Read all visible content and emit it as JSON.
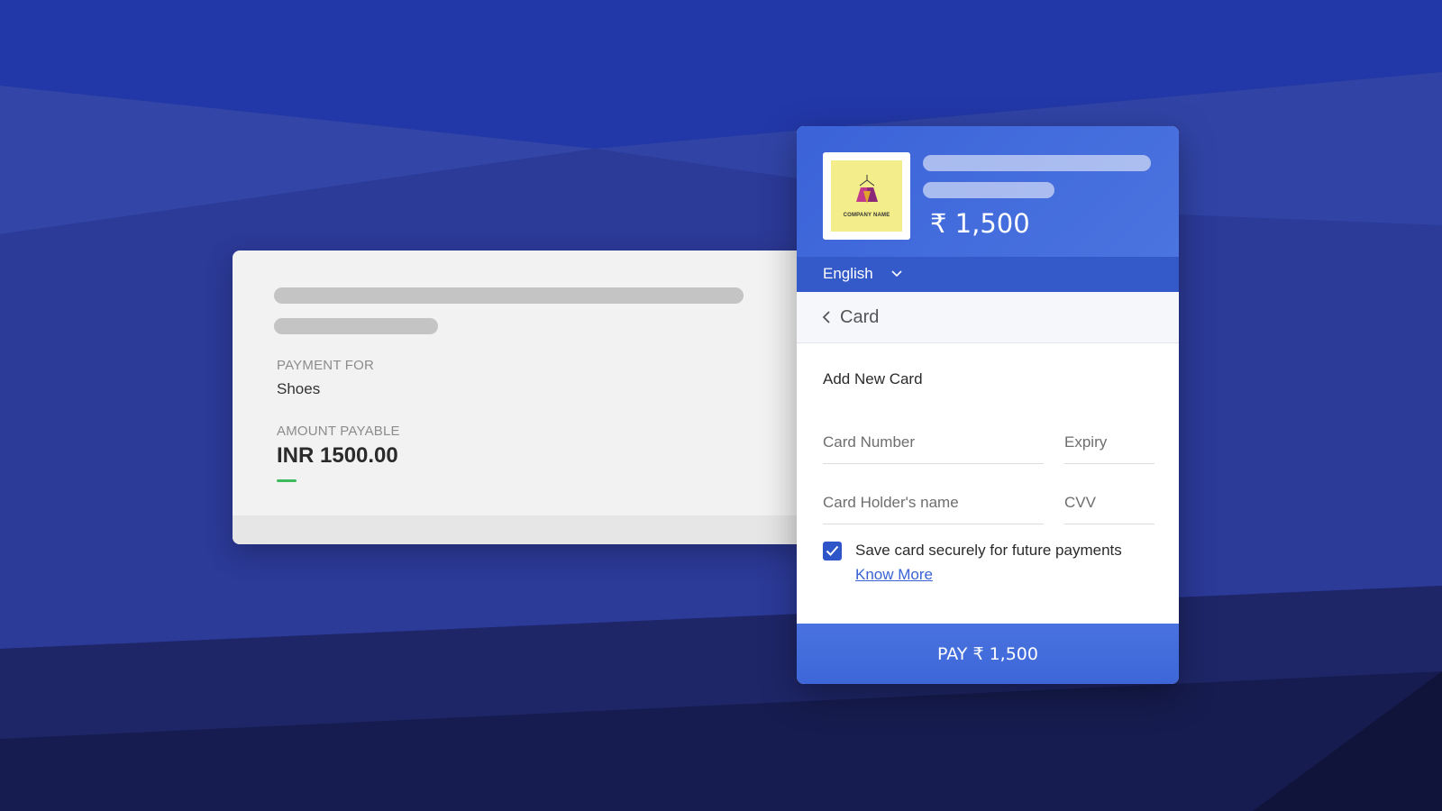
{
  "summary": {
    "payment_for_label": "PAYMENT FOR",
    "payment_for_value": "Shoes",
    "amount_label": "AMOUNT PAYABLE",
    "amount_value": "INR 1500.00"
  },
  "checkout": {
    "logo_text": "COMPANY NAME",
    "amount": "₹ 1,500",
    "language": "English",
    "method_title": "Card",
    "section_title": "Add New Card",
    "fields": {
      "card_number_placeholder": "Card Number",
      "expiry_placeholder": "Expiry",
      "holder_name_placeholder": "Card Holder's name",
      "cvv_placeholder": "CVV"
    },
    "save_card": {
      "checked": true,
      "label": "Save card securely for future payments",
      "link": "Know More"
    },
    "pay_button": "PAY ₹ 1,500"
  },
  "colors": {
    "accent": "#3b63d8",
    "success": "#3dbb5c",
    "logo_bg": "#f3ee8b"
  },
  "icons": {
    "language_dropdown": "chevron-down-icon",
    "back": "chevron-left-icon",
    "checkbox": "check-icon",
    "logo": "company-logo"
  }
}
